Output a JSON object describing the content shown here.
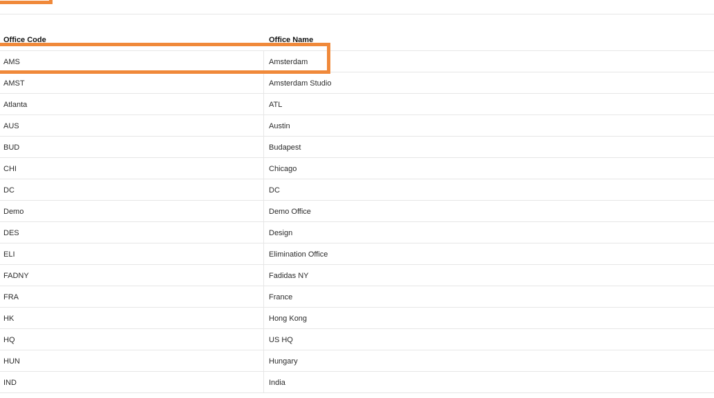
{
  "table": {
    "headers": {
      "code": "Office Code",
      "name": "Office Name"
    },
    "rows": [
      {
        "code": "AMS",
        "name": "Amsterdam"
      },
      {
        "code": "AMST",
        "name": "Amsterdam Studio"
      },
      {
        "code": "Atlanta",
        "name": "ATL"
      },
      {
        "code": "AUS",
        "name": "Austin"
      },
      {
        "code": "BUD",
        "name": "Budapest"
      },
      {
        "code": "CHI",
        "name": "Chicago"
      },
      {
        "code": "DC",
        "name": "DC"
      },
      {
        "code": "Demo",
        "name": "Demo Office"
      },
      {
        "code": "DES",
        "name": "Design"
      },
      {
        "code": "ELI",
        "name": "Elimination Office"
      },
      {
        "code": "FADNY",
        "name": "Fadidas NY"
      },
      {
        "code": "FRA",
        "name": "France"
      },
      {
        "code": "HK",
        "name": "Hong Kong"
      },
      {
        "code": "HQ",
        "name": "US HQ"
      },
      {
        "code": "HUN",
        "name": "Hungary"
      },
      {
        "code": "IND",
        "name": "India"
      }
    ]
  },
  "colors": {
    "highlight": "#f0893a",
    "divider": "#e6e6e6"
  }
}
